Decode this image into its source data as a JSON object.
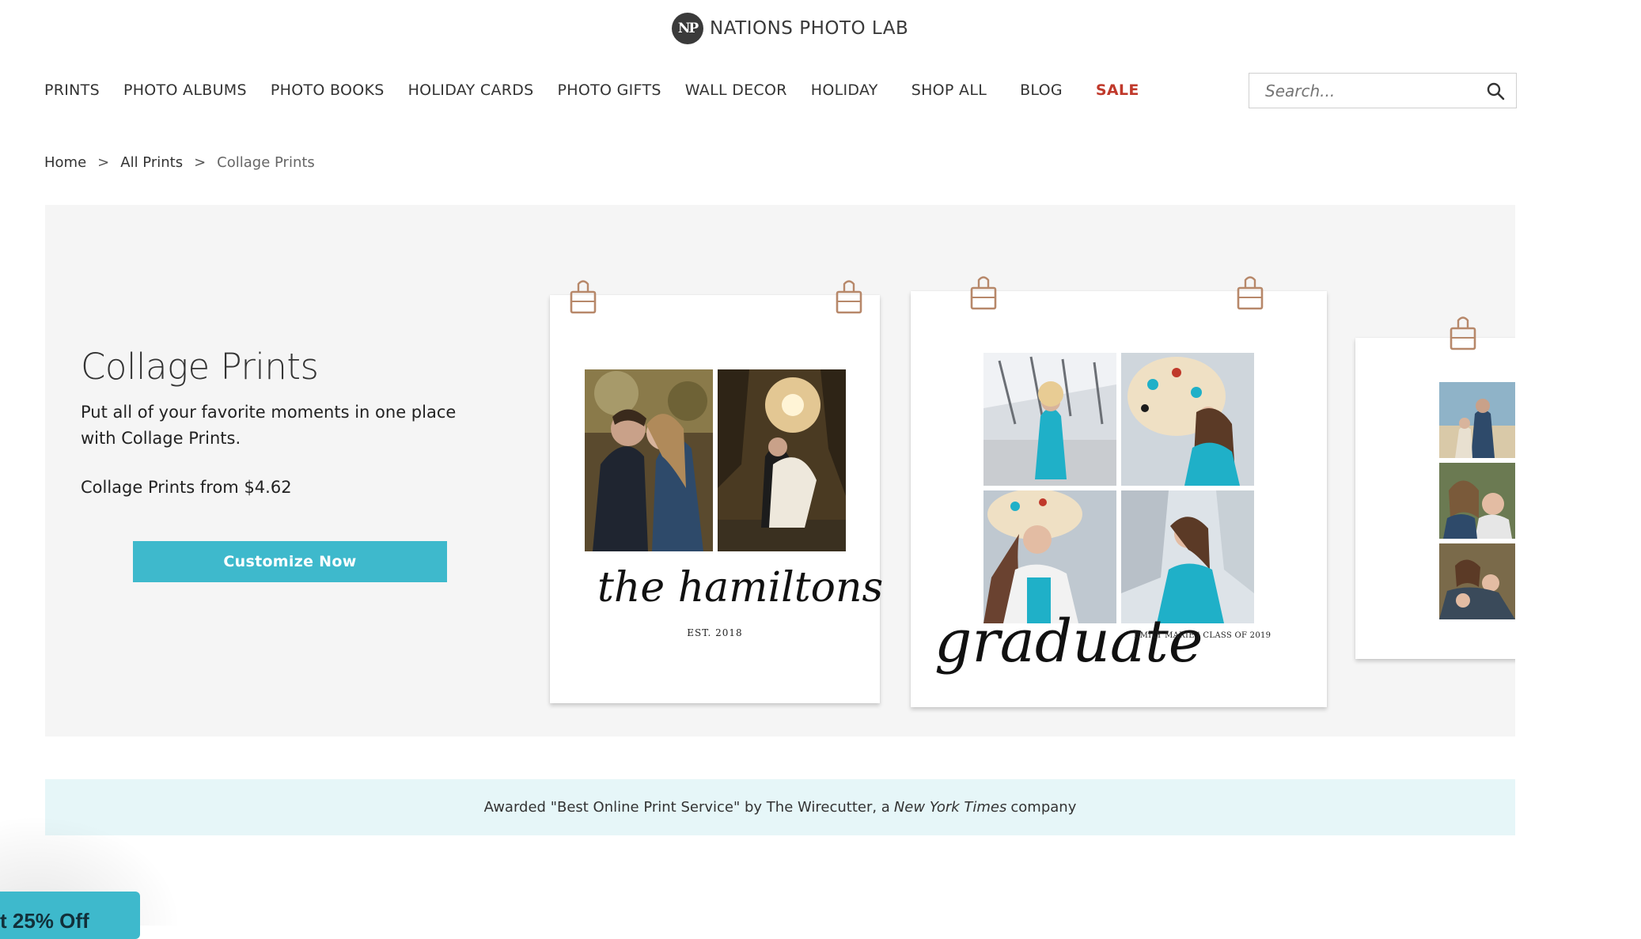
{
  "brand": {
    "logo_mark": "NP",
    "name": "NATIONS PHOTO LAB"
  },
  "nav": {
    "items": [
      "PRINTS",
      "PHOTO ALBUMS",
      "PHOTO BOOKS",
      "HOLIDAY CARDS",
      "PHOTO GIFTS",
      "WALL DECOR",
      "HOLIDAY",
      "SHOP ALL",
      "BLOG"
    ],
    "sale": "SALE"
  },
  "search": {
    "placeholder": "Search...",
    "icon": "search-icon"
  },
  "breadcrumb": {
    "home": "Home",
    "all_prints": "All Prints",
    "current": "Collage Prints",
    "separator": ">"
  },
  "hero": {
    "title": "Collage Prints",
    "description": "Put all of your favorite moments in one place with Collage Prints.",
    "price_text": "Collage Prints from $4.62",
    "cta_label": "Customize Now"
  },
  "samples": {
    "print1": {
      "script": "the hamiltons",
      "caption": "EST. 2018"
    },
    "print2": {
      "script": "graduate",
      "caption": "EMILY MARIE | CLASS OF 2019"
    }
  },
  "award": {
    "prefix": "Awarded \"Best Online Print Service\" by The Wirecutter, a",
    "publication": "New York Times",
    "suffix": "company"
  },
  "promo": {
    "label": "t 25% Off"
  },
  "colors": {
    "accent": "#3eb9cc",
    "sale": "#c0392b",
    "award_bg": "#e6f6f8",
    "hero_bg": "#f5f5f5"
  }
}
